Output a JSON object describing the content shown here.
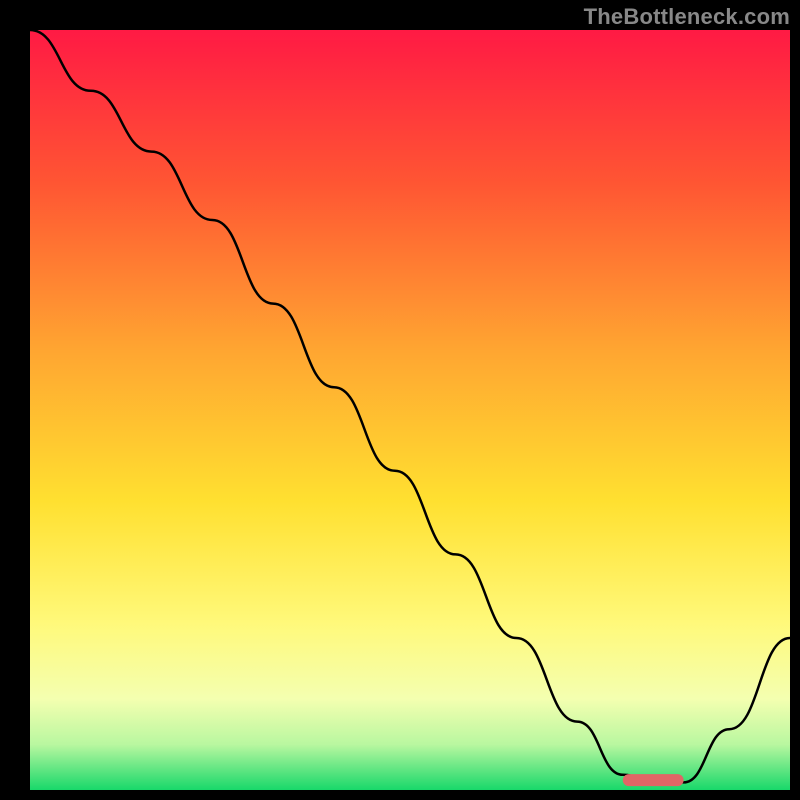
{
  "watermark": "TheBottleneck.com",
  "chart_data": {
    "type": "line",
    "title": "",
    "xlabel": "",
    "ylabel": "",
    "xlim": [
      0,
      100
    ],
    "ylim": [
      0,
      100
    ],
    "series": [
      {
        "name": "bottleneck-curve",
        "color": "#000000",
        "x": [
          0,
          8,
          16,
          24,
          32,
          40,
          48,
          56,
          64,
          72,
          78,
          82,
          86,
          92,
          100
        ],
        "y": [
          100,
          92,
          84,
          75,
          64,
          53,
          42,
          31,
          20,
          9,
          2,
          1,
          1,
          8,
          20
        ]
      }
    ],
    "annotations": [
      {
        "name": "optimal-marker",
        "type": "rounded-rect",
        "x_start": 78,
        "x_end": 86,
        "y": 1.3,
        "color": "#e06666"
      }
    ],
    "background_gradient": {
      "type": "linear-vertical",
      "stops": [
        {
          "offset": 0.0,
          "color": "#ff1a44"
        },
        {
          "offset": 0.2,
          "color": "#ff5533"
        },
        {
          "offset": 0.42,
          "color": "#ffa531"
        },
        {
          "offset": 0.62,
          "color": "#ffe030"
        },
        {
          "offset": 0.78,
          "color": "#fff97a"
        },
        {
          "offset": 0.88,
          "color": "#f4ffb0"
        },
        {
          "offset": 0.94,
          "color": "#b9f7a0"
        },
        {
          "offset": 1.0,
          "color": "#18d86a"
        }
      ]
    }
  }
}
